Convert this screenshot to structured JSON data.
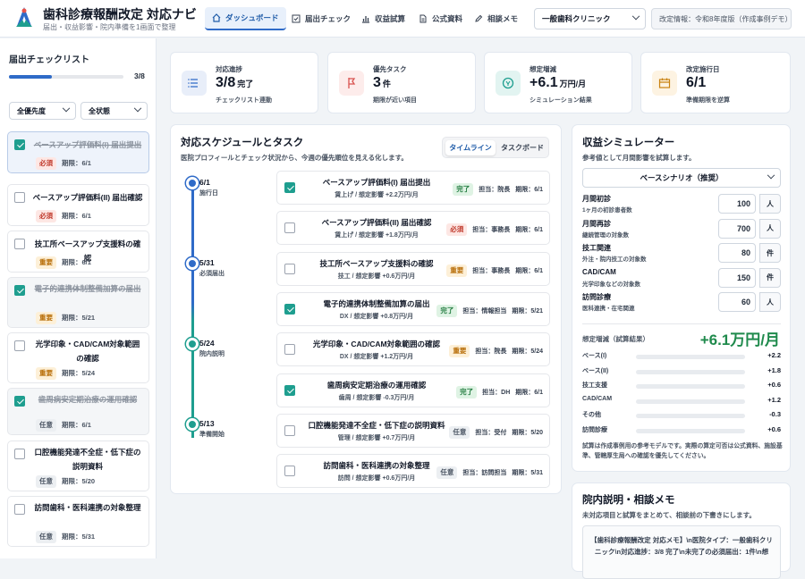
{
  "header": {
    "app_title": "歯科診療報酬改定 対応ナビ",
    "app_subtitle": "届出・収益影響・院内準備を1画面で整理",
    "nav": [
      {
        "label": "ダッシュボード",
        "icon": "home-icon",
        "active": true
      },
      {
        "label": "届出チェック",
        "icon": "checkbox-icon"
      },
      {
        "label": "収益試算",
        "icon": "bar-chart-icon"
      },
      {
        "label": "公式資料",
        "icon": "document-icon"
      },
      {
        "label": "相談メモ",
        "icon": "pencil-icon"
      }
    ],
    "clinic_select": "一般歯科クリニック",
    "revision_info": "改定情報：令和8年度版（作成事例デモ）"
  },
  "sidebar": {
    "title": "届出チェックリスト",
    "progress_text": "3/8",
    "progress_fraction": 0.375,
    "filter_priority": "全優先度",
    "filter_status": "全状態",
    "due_prefix": "期限：",
    "items": [
      {
        "title": "ベースアップ評価料(I) 届出提出",
        "badge": "必須",
        "due": "6/1",
        "done": true,
        "selected": true
      },
      {
        "title": "ベースアップ評価料(II) 届出確認",
        "badge": "必須",
        "due": "6/1",
        "done": false
      },
      {
        "title": "技工所ベースアップ支援料の確認",
        "badge": "重要",
        "due": "6/1",
        "done": false
      },
      {
        "title": "電子的連携体制整備加算の届出",
        "badge": "重要",
        "due": "5/21",
        "done": true
      },
      {
        "title": "光学印象・CAD/CAM対象範囲の確認",
        "badge": "重要",
        "due": "5/24",
        "done": false
      },
      {
        "title": "歯周病安定期治療の運用確認",
        "badge": "任意",
        "due": "6/1",
        "done": true
      },
      {
        "title": "口腔機能発達不全症・低下症の説明資料",
        "badge": "任意",
        "due": "5/20",
        "done": false
      },
      {
        "title": "訪問歯科・医科連携の対象整理",
        "badge": "任意",
        "due": "5/31",
        "done": false
      }
    ]
  },
  "kpis": [
    {
      "label": "対応進捗",
      "value": "3/8",
      "unit": "完了",
      "sub": "チェックリスト連動",
      "icon": "list-icon",
      "color": "#e8eef9"
    },
    {
      "label": "優先タスク",
      "value": "3",
      "unit": "件",
      "sub": "期限が近い項目",
      "icon": "flag-icon",
      "color": "#fdeceb"
    },
    {
      "label": "想定増減",
      "value": "+6.1",
      "unit": "万円/月",
      "sub": "シミュレーション結果",
      "icon": "coin-icon",
      "color": "#e2f4f1"
    },
    {
      "label": "改定施行日",
      "value": "6/1",
      "unit": "",
      "sub": "準備期限を逆算",
      "icon": "calendar-icon",
      "color": "#fdf3e2"
    }
  ],
  "schedule": {
    "title": "対応スケジュールとタスク",
    "subtitle": "医院プロフィールとチェック状況から、今週の優先順位を見える化します。",
    "tab_timeline": "タイムライン",
    "tab_taskboard": "タスクボード",
    "milestones": [
      {
        "date": "6/1",
        "label": "施行日",
        "color": "#2f6bc8"
      },
      {
        "date": "5/31",
        "label": "必須届出",
        "color": "#2f6bc8"
      },
      {
        "date": "5/24",
        "label": "院内説明",
        "color": "#1e9e8f"
      },
      {
        "date": "5/13",
        "label": "準備開始",
        "color": "#1e9e8f"
      }
    ],
    "owner_prefix": "担当：",
    "due_prefix": "期限：",
    "tasks": [
      {
        "title": "ベースアップ評価料(I) 届出提出",
        "sub": "賃上げ / 想定影響 +2.2万円/月",
        "badge": "完了",
        "owner": "院長",
        "due": "6/1",
        "done": true
      },
      {
        "title": "ベースアップ評価料(II) 届出確認",
        "sub": "賃上げ / 想定影響 +1.8万円/月",
        "badge": "必須",
        "owner": "事務長",
        "due": "6/1",
        "done": false
      },
      {
        "title": "技工所ベースアップ支援料の確認",
        "sub": "技工 / 想定影響 +0.6万円/月",
        "badge": "重要",
        "owner": "事務長",
        "due": "6/1",
        "done": false
      },
      {
        "title": "電子的連携体制整備加算の届出",
        "sub": "DX / 想定影響 +0.8万円/月",
        "badge": "完了",
        "owner": "情報担当",
        "due": "5/21",
        "done": true
      },
      {
        "title": "光学印象・CAD/CAM対象範囲の確認",
        "sub": "DX / 想定影響 +1.2万円/月",
        "badge": "重要",
        "owner": "院長",
        "due": "5/24",
        "done": false
      },
      {
        "title": "歯周病安定期治療の運用確認",
        "sub": "歯周 / 想定影響 -0.3万円/月",
        "badge": "完了",
        "owner": "DH",
        "due": "6/1",
        "done": true
      },
      {
        "title": "口腔機能発達不全症・低下症の説明資料",
        "sub": "管理 / 想定影響 +0.7万円/月",
        "badge": "任意",
        "owner": "受付",
        "due": "5/20",
        "done": false
      },
      {
        "title": "訪問歯科・医科連携の対象整理",
        "sub": "訪問 / 想定影響 +0.6万円/月",
        "badge": "任意",
        "owner": "訪問担当",
        "due": "5/31",
        "done": false
      }
    ]
  },
  "simulator": {
    "title": "収益シミュレーター",
    "subtitle": "参考値として月間影響を試算します。",
    "scenario": "ベースシナリオ（推奨）",
    "inputs": [
      {
        "label": "月間初診",
        "desc": "1ヶ月の初診患者数",
        "value": "100",
        "unit": "人"
      },
      {
        "label": "月間再診",
        "desc": "継続管理の対象数",
        "value": "700",
        "unit": "人"
      },
      {
        "label": "技工関連",
        "desc": "外注・院内技工の対象数",
        "value": "80",
        "unit": "件"
      },
      {
        "label": "CAD/CAM",
        "desc": "光学印象などの対象数",
        "value": "150",
        "unit": "件"
      },
      {
        "label": "訪問診療",
        "desc": "医科連携・在宅関連",
        "value": "60",
        "unit": "人"
      }
    ],
    "result_label": "想定増減（試算結果）",
    "result_value": "+6.1万円/月",
    "breakdown": [
      {
        "label": "ベース(I)",
        "value": "+2.2",
        "fraction": 0.0
      },
      {
        "label": "ベース(II)",
        "value": "+1.8",
        "fraction": 0.0
      },
      {
        "label": "技工支援",
        "value": "+0.6",
        "fraction": 0.0
      },
      {
        "label": "CAD/CAM",
        "value": "+1.2",
        "fraction": 0.0
      },
      {
        "label": "その他",
        "value": "-0.3",
        "fraction": 0.0
      },
      {
        "label": "訪問診療",
        "value": "+0.6",
        "fraction": 0.0
      }
    ],
    "note": "試算は作成事例用の参考モデルです。実際の算定可否は公式資料、施設基準、管轄厚生局への確認を優先してください。"
  },
  "memo": {
    "title": "院内説明・相談メモ",
    "subtitle": "未対応項目と試算をまとめて、相談前の下書きにします。",
    "text": "【歯科診療報酬改定 対応メモ】\\n医院タイプ：一般歯科クリニック\\n対応進捗：3/8 完了\\n未完了の必須届出：1件\\n想"
  },
  "colors": {
    "primary": "#2f6bc8",
    "accent": "#1e9e8f",
    "positive": "#1f8a4c"
  }
}
